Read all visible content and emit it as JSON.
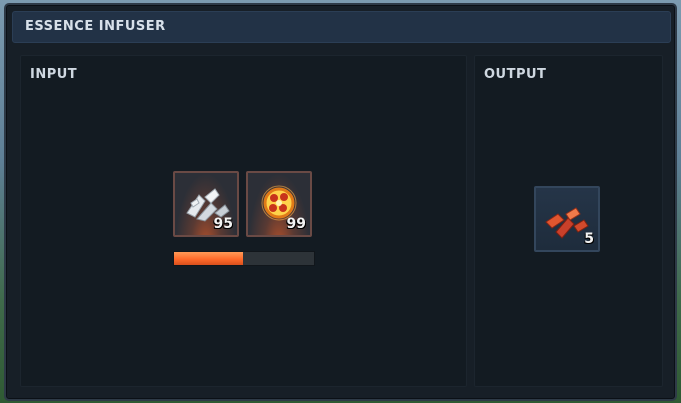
{
  "window": {
    "title": "ESSENCE INFUSER"
  },
  "input": {
    "label": "INPUT",
    "slots": [
      {
        "item_icon": "silver-shards-icon",
        "count": "95"
      },
      {
        "item_icon": "fire-essence-orb-icon",
        "count": "99"
      }
    ],
    "progress": 0.49
  },
  "output": {
    "label": "OUTPUT",
    "slots": [
      {
        "item_icon": "red-crystal-shards-icon",
        "count": "5"
      }
    ]
  },
  "colors": {
    "accent_progress": "#ff6a2a",
    "title_bar": "#223246",
    "panel_bg": "#131b22"
  }
}
